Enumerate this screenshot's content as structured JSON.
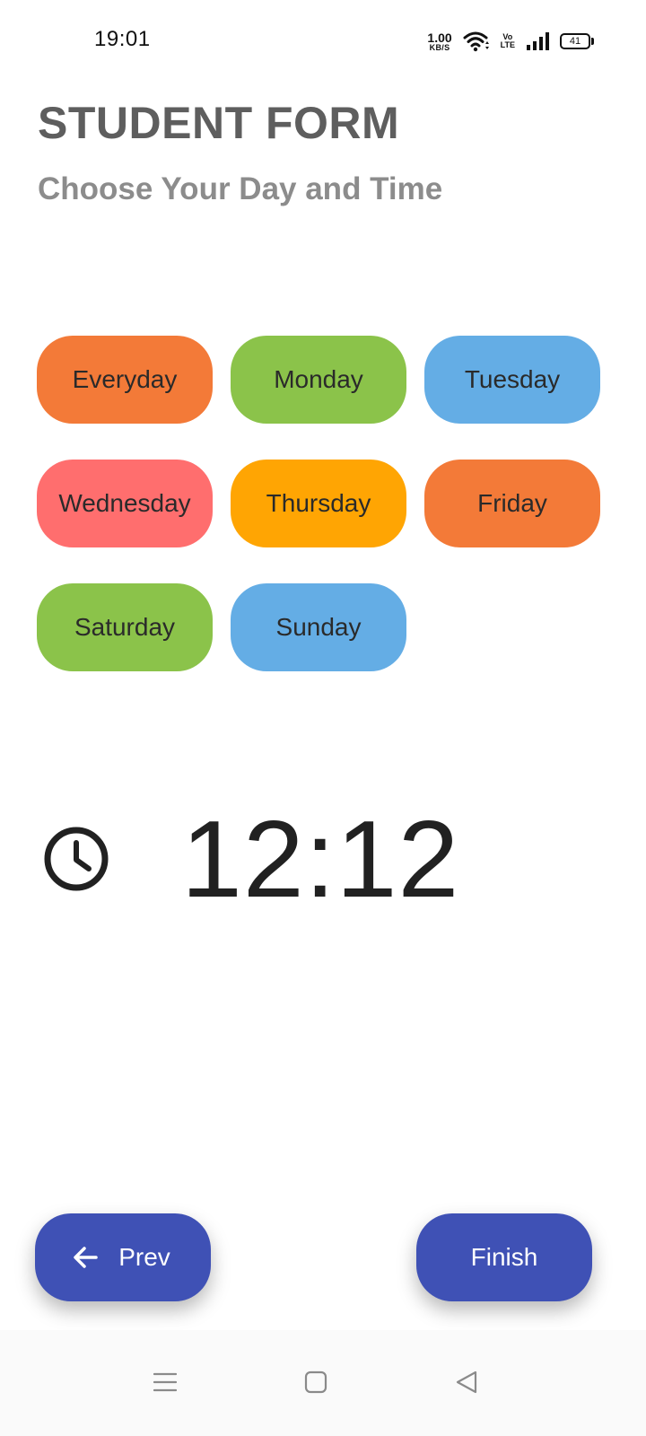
{
  "status_bar": {
    "time": "19:01",
    "net_speed_value": "1.00",
    "net_speed_unit": "KB/S",
    "volte_top": "Vo",
    "volte_bottom": "LTE",
    "battery": "41"
  },
  "header": {
    "title": "STUDENT FORM",
    "subtitle": "Choose Your Day and Time"
  },
  "days": [
    {
      "label": "Everyday",
      "color": "#f37a38"
    },
    {
      "label": "Monday",
      "color": "#8bc34a"
    },
    {
      "label": "Tuesday",
      "color": "#64ade5"
    },
    {
      "label": "Wednesday",
      "color": "#ff6e6e"
    },
    {
      "label": "Thursday",
      "color": "#ffa503"
    },
    {
      "label": "Friday",
      "color": "#f37a38"
    },
    {
      "label": "Saturday",
      "color": "#8bc34a"
    },
    {
      "label": "Sunday",
      "color": "#64ade5"
    }
  ],
  "time": {
    "icon": "clock-icon",
    "value": "12:12"
  },
  "actions": {
    "prev_label": "Prev",
    "prev_icon": "arrow-left-icon",
    "finish_label": "Finish",
    "button_color": "#3f51b5"
  },
  "nav": {
    "menu_icon": "menu-icon",
    "home_icon": "home-icon",
    "back_icon": "back-icon"
  }
}
